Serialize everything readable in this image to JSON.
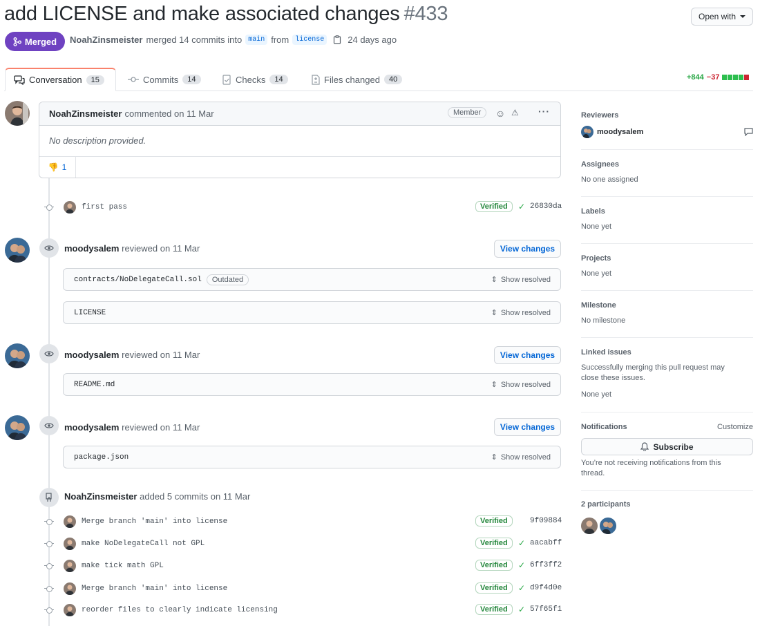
{
  "pr": {
    "title": "add LICENSE and make associated changes",
    "number": "#433",
    "open_with": "Open with",
    "state": "Merged",
    "author": "NoahZinsmeister",
    "merge_text": "merged 14 commits into",
    "base_branch": "main",
    "from_text": "from",
    "head_branch": "license",
    "when": "24 days ago"
  },
  "tabs": [
    {
      "label": "Conversation",
      "count": "15"
    },
    {
      "label": "Commits",
      "count": "14"
    },
    {
      "label": "Checks",
      "count": "14"
    },
    {
      "label": "Files changed",
      "count": "40"
    }
  ],
  "diffstat": {
    "additions": "+844",
    "deletions": "−37",
    "colors": [
      "#2cbe4e",
      "#2cbe4e",
      "#2cbe4e",
      "#2cbe4e",
      "#cb2431"
    ]
  },
  "comment": {
    "author": "NoahZinsmeister",
    "meta": "commented on 11 Mar",
    "badge": "Member",
    "body": "No description provided.",
    "reaction_emoji": "👎",
    "reaction_count": "1"
  },
  "first_commit": {
    "message": "first pass",
    "verified": "Verified",
    "sha": "26830da"
  },
  "reviews": [
    {
      "author": "moodysalem",
      "meta": "reviewed on 11 Mar",
      "button": "View changes",
      "files": [
        {
          "name": "contracts/NoDelegateCall.sol",
          "tag": "Outdated",
          "action": "Show resolved"
        },
        {
          "name": "LICENSE",
          "tag": "",
          "action": "Show resolved"
        }
      ]
    },
    {
      "author": "moodysalem",
      "meta": "reviewed on 11 Mar",
      "button": "View changes",
      "files": [
        {
          "name": "README.md",
          "tag": "",
          "action": "Show resolved"
        }
      ]
    },
    {
      "author": "moodysalem",
      "meta": "reviewed on 11 Mar",
      "button": "View changes",
      "files": [
        {
          "name": "package.json",
          "tag": "",
          "action": "Show resolved"
        }
      ]
    }
  ],
  "commit_group": {
    "author": "NoahZinsmeister",
    "meta": "added 5 commits on 11 Mar"
  },
  "commits": [
    {
      "message": "Merge branch 'main' into license",
      "verified": "Verified",
      "sha": "9f09884",
      "check": false
    },
    {
      "message": "make NoDelegateCall not GPL",
      "verified": "Verified",
      "sha": "aacabff",
      "check": true
    },
    {
      "message": "make tick math GPL",
      "verified": "Verified",
      "sha": "6ff3ff2",
      "check": true
    },
    {
      "message": "Merge branch 'main' into license",
      "verified": "Verified",
      "sha": "d9f4d0e",
      "check": true
    },
    {
      "message": "reorder files to clearly indicate licensing",
      "verified": "Verified",
      "sha": "57f65f1",
      "check": true
    }
  ],
  "sidebar": {
    "reviewers": {
      "heading": "Reviewers",
      "name": "moodysalem"
    },
    "assignees": {
      "heading": "Assignees",
      "value": "No one assigned"
    },
    "labels": {
      "heading": "Labels",
      "value": "None yet"
    },
    "projects": {
      "heading": "Projects",
      "value": "None yet"
    },
    "milestone": {
      "heading": "Milestone",
      "value": "No milestone"
    },
    "linked": {
      "heading": "Linked issues",
      "desc": "Successfully merging this pull request may close these issues.",
      "value": "None yet"
    },
    "notifications": {
      "heading": "Notifications",
      "customize": "Customize",
      "button": "Subscribe",
      "desc": "You’re not receiving notifications from this thread."
    },
    "participants": {
      "heading": "2 participants"
    }
  },
  "colors": {
    "merged": "#6f42c1",
    "link": "#0366d6",
    "verified": "#22863a"
  }
}
